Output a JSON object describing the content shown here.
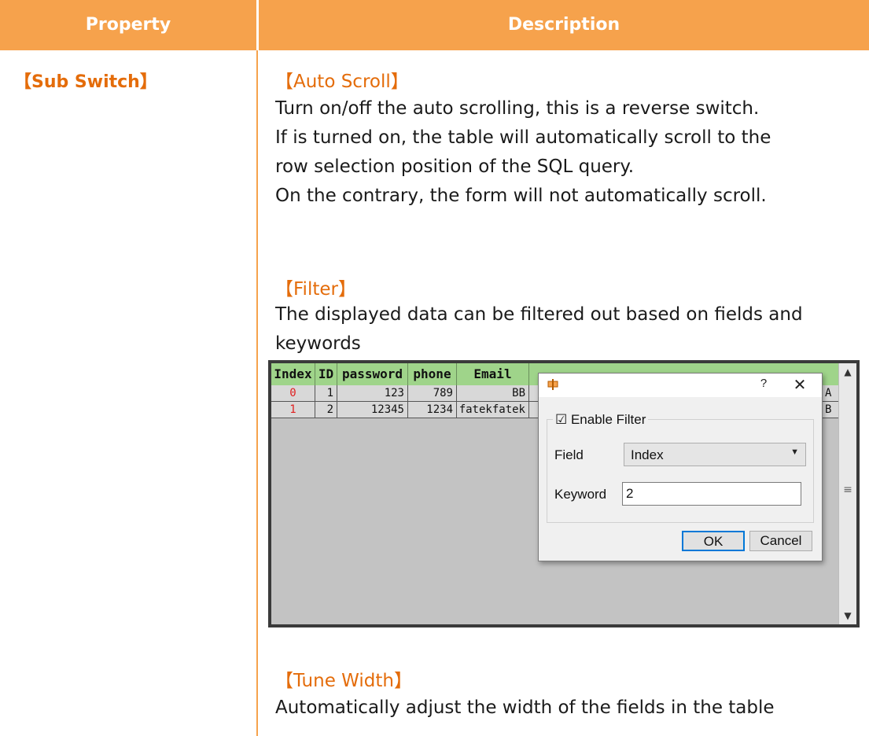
{
  "header": {
    "property": "Property",
    "description": "Description"
  },
  "property_name": "【Sub Switch】",
  "sections": {
    "auto_scroll": {
      "title": "【Auto Scroll】",
      "lines": [
        "Turn on/off the auto scrolling, this is a reverse switch.",
        "If is turned on, the table will automatically scroll to the",
        "row selection position of the SQL query.",
        "On the contrary, the form will not automatically scroll."
      ]
    },
    "filter": {
      "title": "【Filter】",
      "lines": [
        "The displayed data can be filtered out based on fields and",
        "keywords"
      ]
    },
    "tune_width": {
      "title": "【Tune Width】",
      "lines": [
        "Automatically adjust the width of the fields in the table"
      ]
    }
  },
  "table": {
    "columns": [
      "Index",
      "ID",
      "password",
      "phone",
      "Email"
    ],
    "rows": [
      [
        "0",
        "1",
        "123",
        "789",
        "BB",
        "A"
      ],
      [
        "1",
        "2",
        "12345",
        "1234",
        "fatekfatek",
        "B"
      ]
    ]
  },
  "dialog": {
    "help": "?",
    "close": "✕",
    "enable_filter": "☑ Enable Filter",
    "field_label": "Field",
    "field_value": "Index",
    "keyword_label": "Keyword",
    "keyword_value": "2",
    "ok": "OK",
    "cancel": "Cancel"
  },
  "icons": {
    "scroll_up": "▲",
    "scroll_down": "▼",
    "scroll_grip": "≡",
    "combo_arrow": "▼"
  },
  "colors": {
    "header": "#f6a24c",
    "accent_text": "#e46c0a",
    "grid_header": "#9fd48a"
  }
}
